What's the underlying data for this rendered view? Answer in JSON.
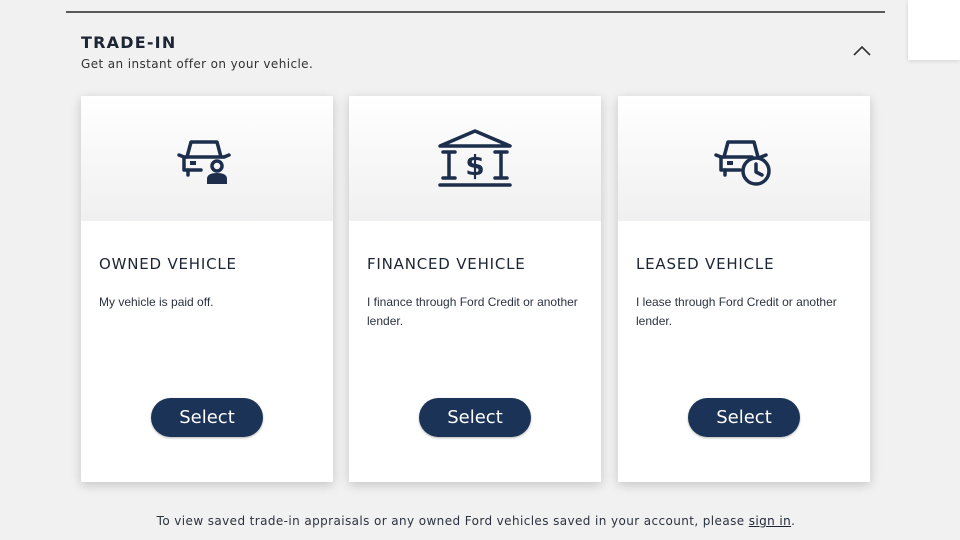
{
  "section": {
    "title": "TRADE-IN",
    "subtitle": "Get an instant offer on your vehicle."
  },
  "cards": [
    {
      "icon": "owned-car-icon",
      "title": "OWNED VEHICLE",
      "description": "My vehicle is paid off.",
      "button": "Select"
    },
    {
      "icon": "bank-dollar-icon",
      "title": "FINANCED VEHICLE",
      "description": "I finance through Ford Credit or another lender.",
      "button": "Select"
    },
    {
      "icon": "car-clock-icon",
      "title": "LEASED VEHICLE",
      "description": "I lease through Ford Credit or another lender.",
      "button": "Select"
    }
  ],
  "footer": {
    "text": "To view saved trade-in appraisals or any owned Ford vehicles saved in your account, please ",
    "link": "sign in",
    "suffix": "."
  },
  "colors": {
    "primary_button": "#1b3356",
    "icon": "#1c2e4c",
    "background": "#f1f1f1"
  }
}
